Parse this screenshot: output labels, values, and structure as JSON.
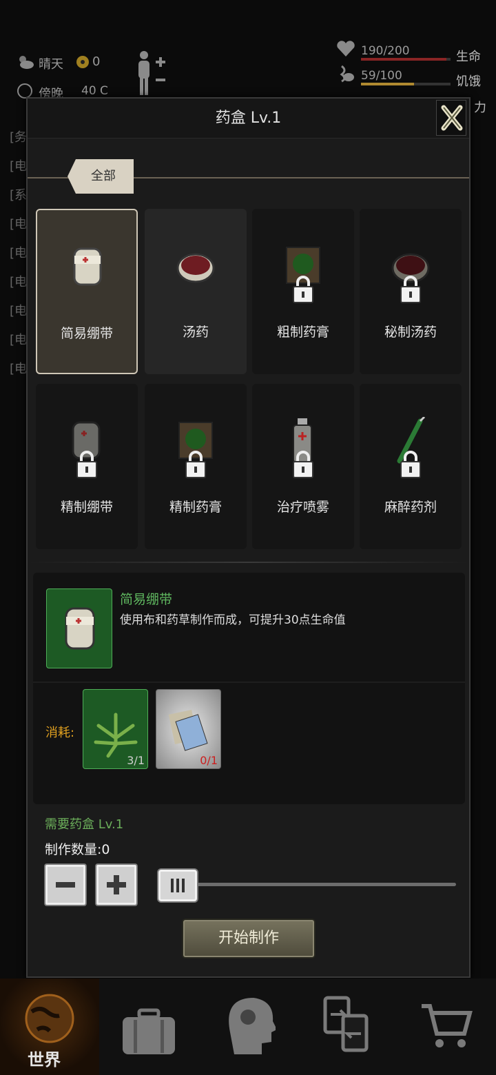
{
  "hud": {
    "weather": "晴天",
    "radiation": "0",
    "time_partial": "傍晚",
    "temp_partial": "40 C",
    "life_value": "190/200",
    "life_label": "生命",
    "life_fraction": 0.95,
    "hunger_value": "59/100",
    "hunger_label": "饥饿",
    "hunger_fraction": 0.59,
    "third_label_partial": "力"
  },
  "background_log": [
    "[务",
    "[电",
    "[系",
    "[电",
    "[电",
    "[电",
    "[电",
    "[电",
    "[电"
  ],
  "panel": {
    "title": "药盒 Lv.1",
    "tab_all": "全部",
    "items": [
      {
        "name": "简易绷带",
        "locked": false,
        "selected": true
      },
      {
        "name": "汤药",
        "locked": false,
        "selected": false
      },
      {
        "name": "粗制药膏",
        "locked": true,
        "selected": false
      },
      {
        "name": "秘制汤药",
        "locked": true,
        "selected": false
      },
      {
        "name": "精制绷带",
        "locked": true,
        "selected": false
      },
      {
        "name": "精制药膏",
        "locked": true,
        "selected": false
      },
      {
        "name": "治疗喷雾",
        "locked": true,
        "selected": false
      },
      {
        "name": "麻醉药剂",
        "locked": true,
        "selected": false
      }
    ],
    "detail": {
      "name": "简易绷带",
      "description": "使用布和药草制作而成，可提升30点生命值",
      "cost_label": "消耗:",
      "materials": [
        {
          "icon": "herb-icon",
          "count": "3/1",
          "color": "#cfcfcf"
        },
        {
          "icon": "cloth-icon",
          "count": "0/1",
          "color": "#cc1f1f"
        }
      ]
    },
    "requirement": "需要药盒 Lv.1",
    "quantity_label": "制作数量:0",
    "quantity_value": 0,
    "start_button": "开始制作"
  },
  "nav": {
    "world_label": "世界",
    "items": [
      "globe-icon",
      "briefcase-icon",
      "head-gear-icon",
      "swap-doc-icon",
      "cart-icon"
    ]
  },
  "colors": {
    "green_text": "#5fb65f",
    "orange_text": "#e0a020",
    "red_count": "#cc1f1f"
  }
}
